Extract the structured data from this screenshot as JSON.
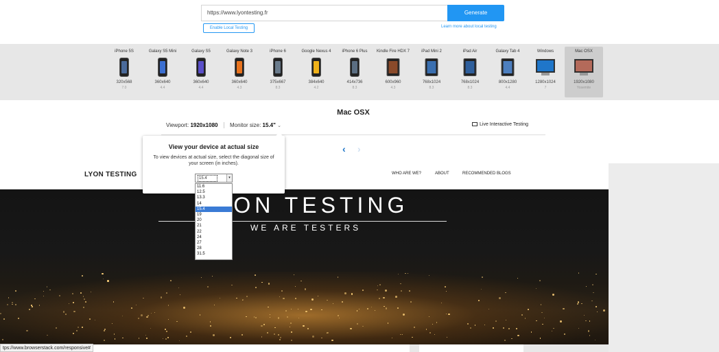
{
  "toolbar": {
    "url_value": "https://www.lyontesting.fr",
    "generate_label": "Generate",
    "local_testing_label": "Enable Local Testing",
    "learn_more_label": "Learn more about local testing"
  },
  "devices": [
    {
      "name": "iPhone 5S",
      "res": "320x568",
      "os": "7.0",
      "kind": "phone",
      "color": "#4a6a9a"
    },
    {
      "name": "Galaxy S5 Mini",
      "res": "360x640",
      "os": "4.4",
      "kind": "phone",
      "color": "#3b6fd1"
    },
    {
      "name": "Galaxy S5",
      "res": "360x640",
      "os": "4.4",
      "kind": "phone",
      "color": "#5a4fc9"
    },
    {
      "name": "Galaxy Note 3",
      "res": "360x640",
      "os": "4.3",
      "kind": "phone",
      "color": "#e8731e"
    },
    {
      "name": "iPhone 6",
      "res": "375x667",
      "os": "8.3",
      "kind": "phone",
      "color": "#6a7b8c"
    },
    {
      "name": "Google Nexus 4",
      "res": "384x640",
      "os": "4.2",
      "kind": "phone",
      "color": "#f0b21a"
    },
    {
      "name": "iPhone 6 Plus",
      "res": "414x736",
      "os": "8.3",
      "kind": "phone",
      "color": "#5b6e82"
    },
    {
      "name": "Kindle Fire HDX 7",
      "res": "600x960",
      "os": "4.3",
      "kind": "tablet",
      "color": "#8a4a2a"
    },
    {
      "name": "iPad Mini 2",
      "res": "768x1024",
      "os": "8.3",
      "kind": "tablet",
      "color": "#3a6fb0"
    },
    {
      "name": "iPad Air",
      "res": "768x1024",
      "os": "8.3",
      "kind": "tablet",
      "color": "#2f5f9c"
    },
    {
      "name": "Galaxy Tab 4",
      "res": "800x1280",
      "os": "4.4",
      "kind": "tablet",
      "color": "#4d7fbf"
    },
    {
      "name": "Windows",
      "res": "1280x1024",
      "os": "7",
      "kind": "monitor",
      "color": "#1f76c9"
    },
    {
      "name": "Mac OSX",
      "res": "1920x1080",
      "os": "Yosemite",
      "kind": "monitor",
      "color": "#b46a5a",
      "active": true
    }
  ],
  "device_info": {
    "title": "Mac OSX",
    "viewport_label": "Viewport:",
    "viewport_value": "1920x1080",
    "monitor_label": "Monitor size:",
    "monitor_value": "15.4\"",
    "live_testing_label": "Live Interactive Testing"
  },
  "popup": {
    "title": "View your device at actual size",
    "text": "To view devices at actual size, select the diagonal size of your screen (in inches).",
    "selected": "15.4",
    "options": [
      "11.6",
      "12.5",
      "13.3",
      "14",
      "15.4",
      "19",
      "20",
      "21",
      "22",
      "24",
      "27",
      "28",
      "31.5"
    ]
  },
  "site": {
    "logo": "LYON TESTING",
    "menu": [
      "WHO ARE WE?",
      "ABOUT",
      "RECOMMENDED BLOGS"
    ],
    "hero_title": "LYON TESTING",
    "hero_subtitle": "WE ARE TESTERS"
  },
  "status_bar": {
    "url": "tps://www.browserstack.com/responsive#"
  },
  "colors": {
    "accent": "#2196f3",
    "strip_bg": "#e7e7e7",
    "selected_option": "#3a7bd5"
  }
}
